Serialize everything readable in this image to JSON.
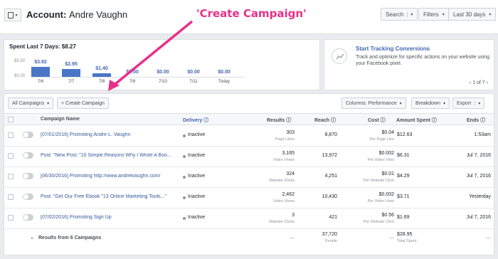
{
  "header": {
    "account_label": "Account:",
    "account_name": "Andre Vaughn",
    "search_label": "Search",
    "filters_label": "Filters",
    "date_range_label": "Last 30 days"
  },
  "annotation": {
    "text": "'Create Campaign'",
    "color": "#e8308a"
  },
  "spent": {
    "title": "Spent Last 7 Days: $8.27",
    "y_top": "$5.00",
    "y_bottom": "$0.00",
    "chart_data": {
      "type": "bar",
      "categories": [
        "7/6",
        "7/7",
        "7/8",
        "7/9",
        "7/10",
        "7/11",
        "Today"
      ],
      "values": [
        3.92,
        2.95,
        1.4,
        0.0,
        0.0,
        0.0,
        0.0
      ],
      "value_labels": [
        "$3.92",
        "$2.95",
        "$1.40",
        "$0.00",
        "$0.00",
        "$0.00",
        "$0.00"
      ],
      "ylim": [
        0,
        5
      ],
      "color": "#4a76c8"
    }
  },
  "tracking": {
    "title": "Start Tracking Conversions",
    "description": "Track and optimize for specific actions on your website using your Facebook pixel.",
    "pager": "1 of 7"
  },
  "toolbar": {
    "all_campaigns": "All Campaigns",
    "create_campaign": "+ Create Campaign",
    "columns": "Columns: Performance",
    "breakdown": "Breakdown",
    "export": "Export"
  },
  "table": {
    "headers": {
      "name": "Campaign Name",
      "delivery": "Delivery",
      "results": "Results",
      "reach": "Reach",
      "cost": "Cost",
      "amount": "Amount Spent",
      "ends": "Ends"
    },
    "rows": [
      {
        "name": "[07/01/2016] Promoting Andre L. Vaughn",
        "delivery": "Inactive",
        "results": "303",
        "results_sub": "Page Likes",
        "reach": "8,870",
        "cost": "$0.04",
        "cost_sub": "Per Page Like",
        "amount": "$12.63",
        "ends": "1:53am"
      },
      {
        "name": "Post: \"New Post: \"10 Simple Reasons Why I Wrote A Boo...",
        "delivery": "Inactive",
        "results": "3,165",
        "results_sub": "Video Views",
        "reach": "13,972",
        "cost": "$0.002",
        "cost_sub": "Per Video View",
        "amount": "$6.31",
        "ends": "Jul 7, 2016"
      },
      {
        "name": "[06/30/2016] Promoting http://www.andrelvaughn.com/",
        "delivery": "Inactive",
        "results": "324",
        "results_sub": "Website Clicks",
        "reach": "4,251",
        "cost": "$0.01",
        "cost_sub": "Per Website Click",
        "amount": "$4.29",
        "ends": "Jul 7, 2016"
      },
      {
        "name": "Post: \"Get Our Free Ebook \"13 Online Marketing Tools...\"",
        "delivery": "Inactive",
        "results": "2,462",
        "results_sub": "Video Views",
        "reach": "10,430",
        "cost": "$0.002",
        "cost_sub": "Per Video View",
        "amount": "$3.71",
        "ends": "Yesterday"
      },
      {
        "name": "[07/02/2016] Promoting Sign Up",
        "delivery": "Inactive",
        "results": "3",
        "results_sub": "Website Clicks",
        "reach": "421",
        "cost": "$0.56",
        "cost_sub": "Per Website Click",
        "amount": "$1.69",
        "ends": "Jul 7, 2016"
      }
    ],
    "footer": {
      "label": "Results from 6 Campaigns",
      "results": "—",
      "reach": "37,720",
      "reach_sub": "People",
      "cost": "—",
      "amount": "$28.95",
      "amount_sub": "Total Spent",
      "ends": "—"
    }
  }
}
